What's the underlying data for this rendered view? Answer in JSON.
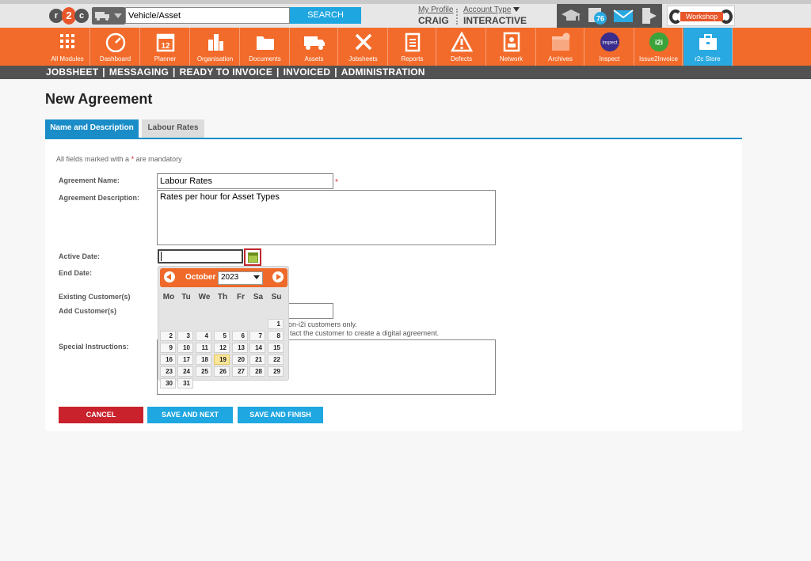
{
  "header": {
    "logo_text": "r2c",
    "search": {
      "value": "Vehicle/Asset",
      "button_label": "SEARCH"
    },
    "profile": {
      "link": "My Profile",
      "name": "CRAIG"
    },
    "account": {
      "link": "Account Type",
      "name": "INTERACTIVE"
    },
    "notification_count": "76",
    "workshop_label": "Workshop"
  },
  "modules": [
    {
      "label": "All Modules",
      "icon": "grid-icon"
    },
    {
      "label": "Dashboard",
      "icon": "gauge-icon"
    },
    {
      "label": "Planner",
      "icon": "calendar-icon"
    },
    {
      "label": "Organisation",
      "icon": "buildings-icon"
    },
    {
      "label": "Documents",
      "icon": "folder-icon"
    },
    {
      "label": "Assets",
      "icon": "truck-icon"
    },
    {
      "label": "Jobsheets",
      "icon": "tools-icon"
    },
    {
      "label": "Reports",
      "icon": "clipboard-icon"
    },
    {
      "label": "Defects",
      "icon": "warning-icon"
    },
    {
      "label": "Network",
      "icon": "address-book-icon"
    },
    {
      "label": "Archives",
      "icon": "archive-box-icon"
    },
    {
      "label": "Inspect",
      "icon": "inspect-icon"
    },
    {
      "label": "Issue2Invoice",
      "icon": "i2i-icon"
    },
    {
      "label": "r2c Store",
      "icon": "briefcase-icon"
    }
  ],
  "subnav": [
    "JOBSHEET",
    "MESSAGING",
    "READY TO INVOICE",
    "INVOICED",
    "ADMINISTRATION"
  ],
  "page": {
    "title": "New Agreement",
    "tabs": [
      "Name and Description",
      "Labour Rates"
    ],
    "mandatory_prefix": "All fields marked with a",
    "mandatory_star": "*",
    "mandatory_suffix": "are mandatory"
  },
  "form": {
    "agreement_name_label": "Agreement Name:",
    "agreement_name_value": "Labour Rates",
    "required_star": "*",
    "agreement_description_label": "Agreement Description:",
    "agreement_description_value": "Rates per hour for Asset Types",
    "active_date_label": "Active Date:",
    "end_date_label": "End Date:",
    "existing_customers_label": "Existing Customer(s)",
    "add_customers_label": "Add Customer(s)",
    "help_line1": "on-i2i customers only.",
    "help_line2": "tact the customer to create a digital agreement.",
    "special_instructions_label": "Special Instructions:"
  },
  "datepicker": {
    "month": "October",
    "year": "2023",
    "days_of_week": [
      "Mo",
      "Tu",
      "We",
      "Th",
      "Fr",
      "Sa",
      "Su"
    ],
    "weeks": [
      [
        "",
        "",
        "",
        "",
        "",
        "",
        "1"
      ],
      [
        "2",
        "3",
        "4",
        "5",
        "6",
        "7",
        "8"
      ],
      [
        "9",
        "10",
        "11",
        "12",
        "13",
        "14",
        "15"
      ],
      [
        "16",
        "17",
        "18",
        "19",
        "20",
        "21",
        "22"
      ],
      [
        "23",
        "24",
        "25",
        "26",
        "27",
        "28",
        "29"
      ],
      [
        "30",
        "31",
        "",
        "",
        "",
        "",
        ""
      ]
    ],
    "highlighted_day": "19"
  },
  "buttons": {
    "cancel": "CANCEL",
    "save_next": "SAVE AND NEXT",
    "save_finish": "SAVE AND FINISH"
  },
  "colors": {
    "orange": "#f36b2a",
    "blue": "#1a8dc8",
    "red": "#c9222c",
    "dark": "#525252"
  }
}
